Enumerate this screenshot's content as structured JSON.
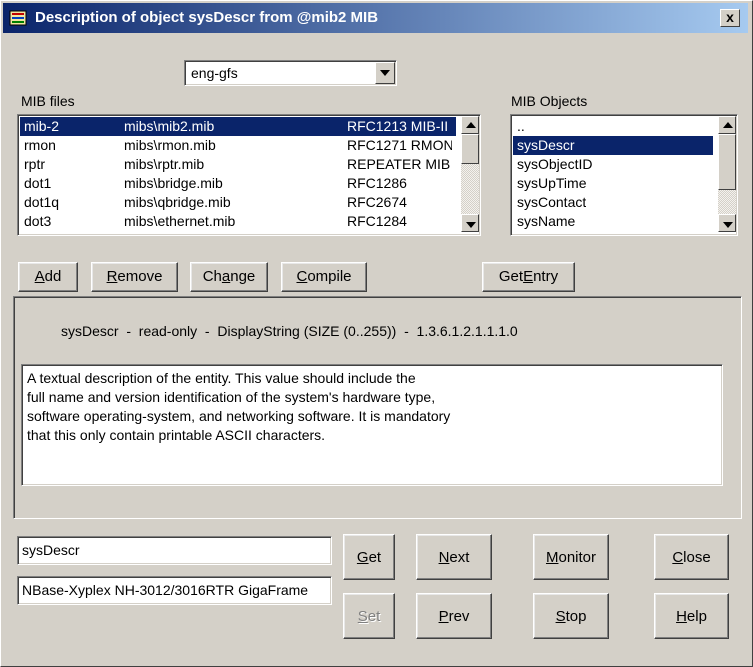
{
  "window": {
    "title": "Description of object sysDescr from @mib2 MIB",
    "close_glyph": "x"
  },
  "combo": {
    "value": "eng-gfs"
  },
  "mib_files": {
    "label": "MIB files",
    "rows": [
      {
        "name": "mib-2",
        "path": "mibs\\mib2.mib",
        "rfc": "RFC1213 MIB-II"
      },
      {
        "name": "rmon",
        "path": "mibs\\rmon.mib",
        "rfc": "RFC1271 RMON"
      },
      {
        "name": "rptr",
        "path": "mibs\\rptr.mib",
        "rfc": "REPEATER MIB"
      },
      {
        "name": "dot1",
        "path": "mibs\\bridge.mib",
        "rfc": "RFC1286"
      },
      {
        "name": "dot1q",
        "path": "mibs\\qbridge.mib",
        "rfc": "RFC2674"
      },
      {
        "name": "dot3",
        "path": "mibs\\ethernet.mib",
        "rfc": "RFC1284"
      }
    ]
  },
  "mib_objects": {
    "label": "MIB Objects",
    "items": [
      "..",
      "sysDescr",
      "sysObjectID",
      "sysUpTime",
      "sysContact",
      "sysName"
    ]
  },
  "buttons": {
    "add": {
      "u": "A",
      "rest": "dd"
    },
    "remove": {
      "u": "R",
      "rest": "emove"
    },
    "change": {
      "pre": "Ch",
      "u": "a",
      "rest": "nge"
    },
    "compile": {
      "u": "C",
      "rest": "ompile"
    },
    "get_entry": {
      "pre": "Get ",
      "u": "E",
      "rest": "ntry"
    },
    "get": {
      "u": "G",
      "rest": "et"
    },
    "set": {
      "u": "S",
      "rest": "et"
    },
    "next": {
      "u": "N",
      "rest": "ext"
    },
    "prev": {
      "u": "P",
      "rest": "rev"
    },
    "monitor": {
      "u": "M",
      "rest": "onitor"
    },
    "stop": {
      "u": "S",
      "rest": "top"
    },
    "close": {
      "u": "C",
      "rest": "lose"
    },
    "help": {
      "u": "H",
      "rest": "elp"
    }
  },
  "object_info": {
    "signature": "sysDescr  -  read-only  -  DisplayString (SIZE (0..255))  -  1.3.6.1.2.1.1.1.0",
    "description": [
      "A textual description of the entity.  This value should include the",
      "full name and version identification of the system's hardware type,",
      "software operating-system, and networking software.  It is mandatory",
      "that this only contain printable ASCII characters."
    ]
  },
  "fields": {
    "object_name": "sysDescr",
    "value": "NBase-Xyplex NH-3012/3016RTR GigaFrame"
  },
  "colors": {
    "title_start": "#0a246a",
    "title_end": "#a6caf0",
    "selection": "#0a246a",
    "face": "#d4d0c8"
  }
}
